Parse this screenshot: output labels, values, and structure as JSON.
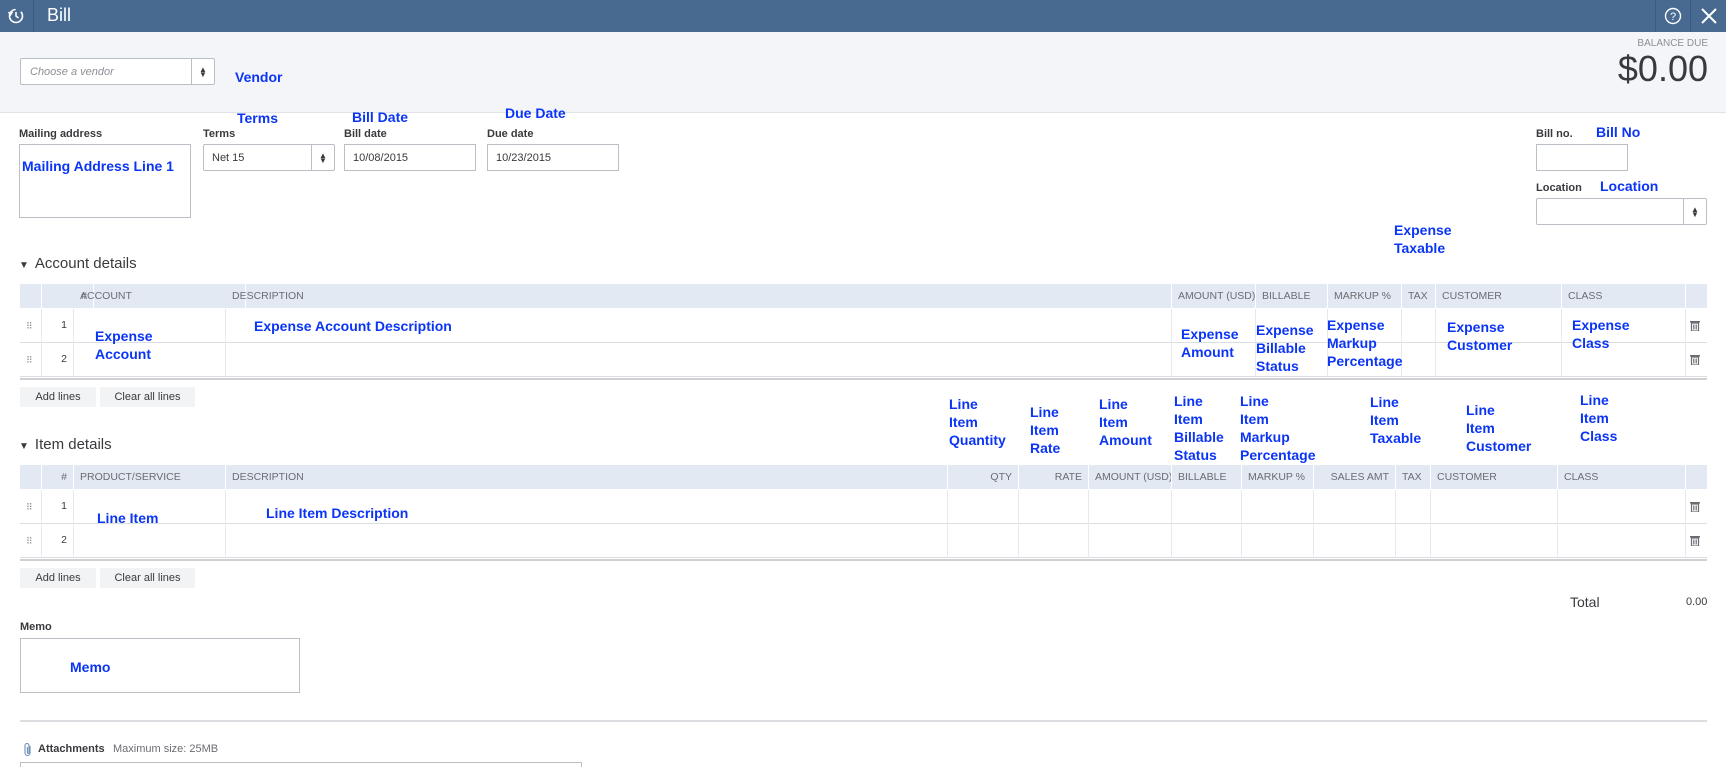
{
  "window": {
    "title": "Bill"
  },
  "header": {
    "vendor_placeholder": "Choose a vendor",
    "balance_due_label": "BALANCE DUE",
    "balance_due_value": "$0.00"
  },
  "form": {
    "mailing_address_label": "Mailing address",
    "terms_label": "Terms",
    "terms_value": "Net 15",
    "bill_date_label": "Bill date",
    "bill_date_value": "10/08/2015",
    "due_date_label": "Due date",
    "due_date_value": "10/23/2015",
    "bill_no_label": "Bill no.",
    "location_label": "Location"
  },
  "annotations": {
    "vendor": "Vendor",
    "terms": "Terms",
    "bill_date": "Bill Date",
    "due_date": "Due Date",
    "mailing_address": "Mailing Address Line 1",
    "bill_no": "Bill No",
    "location": "Location",
    "expense_taxable": [
      "Expense",
      "Taxable"
    ],
    "expense_account": [
      "Expense",
      "Account"
    ],
    "expense_account_description": "Expense Account Description",
    "expense_amount": [
      "Expense",
      "Amount"
    ],
    "expense_billable_status": [
      "Expense",
      "Billable",
      "Status"
    ],
    "expense_markup_percentage": [
      "Expense",
      "Markup",
      "Percentage"
    ],
    "expense_customer": [
      "Expense",
      "Customer"
    ],
    "expense_class": [
      "Expense",
      "Class"
    ],
    "line_item_quantity": [
      "Line",
      "Item",
      "Quantity"
    ],
    "line_item_rate": [
      "Line",
      "Item",
      "Rate"
    ],
    "line_item_amount": [
      "Line",
      "Item",
      "Amount"
    ],
    "line_item_billable_status": [
      "Line",
      "Item",
      "Billable",
      "Status"
    ],
    "line_item_markup_percentage": [
      "Line",
      "Item",
      "Markup",
      "Percentage"
    ],
    "line_item_taxable": [
      "Line",
      "Item",
      "Taxable"
    ],
    "line_item_customer": [
      "Line",
      "Item",
      "Customer"
    ],
    "line_item_class": [
      "Line",
      "Item",
      "Class"
    ],
    "line_item": "Line Item",
    "line_item_description": "Line Item Description",
    "memo": "Memo"
  },
  "account_details": {
    "title": "Account details",
    "columns": [
      "#",
      "ACCOUNT",
      "DESCRIPTION",
      "AMOUNT (USD)",
      "BILLABLE",
      "MARKUP %",
      "TAX",
      "CUSTOMER",
      "CLASS"
    ],
    "rows": [
      "1",
      "2"
    ],
    "add_lines": "Add lines",
    "clear_all_lines": "Clear all lines"
  },
  "item_details": {
    "title": "Item details",
    "columns": [
      "#",
      "PRODUCT/SERVICE",
      "DESCRIPTION",
      "QTY",
      "RATE",
      "AMOUNT (USD)",
      "BILLABLE",
      "MARKUP %",
      "SALES AMT",
      "TAX",
      "CUSTOMER",
      "CLASS"
    ],
    "rows": [
      "1",
      "2"
    ],
    "add_lines": "Add lines",
    "clear_all_lines": "Clear all lines"
  },
  "totals": {
    "total_label": "Total",
    "total_value": "0.00"
  },
  "memo": {
    "label": "Memo"
  },
  "attachments": {
    "label": "Attachments",
    "max_size": "Maximum size: 25MB"
  },
  "colors": {
    "topbar": "#486a91",
    "annotation": "#0b35f5",
    "table_header": "#e3e9f2"
  },
  "icons": [
    "recent-transactions-icon",
    "help-icon",
    "close-icon",
    "trash-icon",
    "drag-handle-icon",
    "paperclip-icon",
    "caret-down-icon"
  ]
}
